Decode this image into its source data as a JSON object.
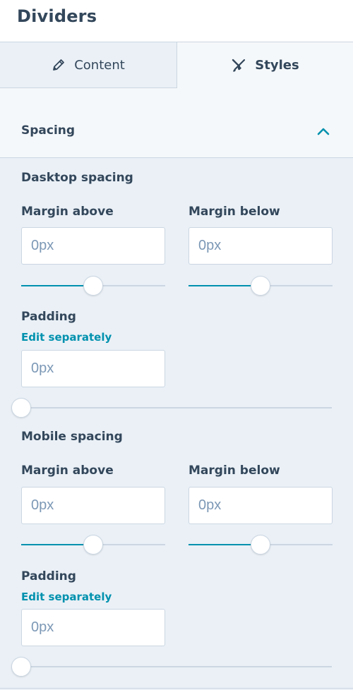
{
  "panel": {
    "title": "Dividers"
  },
  "tabs": [
    {
      "label": "Content",
      "icon": "pencil-icon",
      "active": false
    },
    {
      "label": "Styles",
      "icon": "brush-icon",
      "active": true
    }
  ],
  "section": {
    "title": "Spacing",
    "expanded": true,
    "accent_color": "#0091ae"
  },
  "desktop": {
    "title": "Dasktop spacing",
    "margin_above": {
      "label": "Margin above",
      "value": "",
      "placeholder": "0px",
      "slider_level": 0.5
    },
    "margin_below": {
      "label": "Margin below",
      "value": "",
      "placeholder": "0px",
      "slider_level": 0.5
    },
    "padding": {
      "label": "Padding",
      "edit_link": "Edit separately",
      "value": "",
      "placeholder": "0px",
      "slider_level": 0
    }
  },
  "mobile": {
    "title": "Mobile spacing",
    "margin_above": {
      "label": "Margin above",
      "value": "",
      "placeholder": "0px",
      "slider_level": 0.5
    },
    "margin_below": {
      "label": "Margin below",
      "value": "",
      "placeholder": "0px",
      "slider_level": 0.5
    },
    "padding": {
      "label": "Padding",
      "edit_link": "Edit separately",
      "value": "",
      "placeholder": "0px",
      "slider_level": 0
    }
  }
}
